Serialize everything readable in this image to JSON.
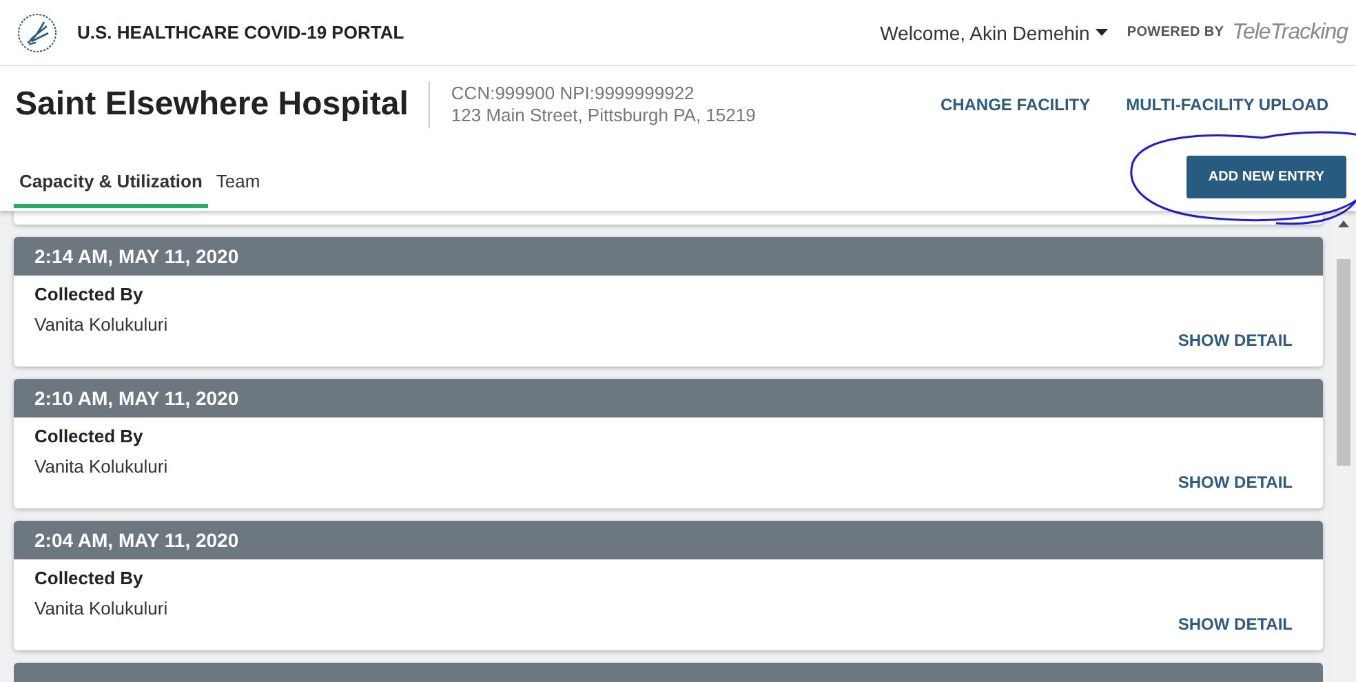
{
  "header": {
    "portal_title": "U.S. HEALTHCARE COVID-19 PORTAL",
    "user_menu": "Welcome, Akin Demehin",
    "powered_by": "POWERED BY",
    "brand": "TeleTracking"
  },
  "facility": {
    "name": "Saint Elsewhere Hospital",
    "ids": "CCN:999900 NPI:9999999922",
    "address": "123 Main Street, Pittsburgh PA, 15219"
  },
  "actions": [
    "CHANGE FACILITY",
    "MULTI-FACILITY UPLOAD"
  ],
  "tabs": [
    {
      "label": "Capacity & Utilization",
      "selected": true
    },
    {
      "label": "Team",
      "selected": false
    }
  ],
  "add_button": "ADD NEW ENTRY",
  "entries": [
    {
      "time": "2:14 AM, MAY 11, 2020",
      "label": "Collected By",
      "name": "Vanita Kolukuluri",
      "action": "SHOW DETAIL"
    },
    {
      "time": "2:10 AM, MAY 11, 2020",
      "label": "Collected By",
      "name": "Vanita Kolukuluri",
      "action": "SHOW DETAIL"
    },
    {
      "time": "2:04 AM, MAY 11, 2020",
      "label": "Collected By",
      "name": "Vanita Kolukuluri",
      "action": "SHOW DETAIL"
    }
  ]
}
